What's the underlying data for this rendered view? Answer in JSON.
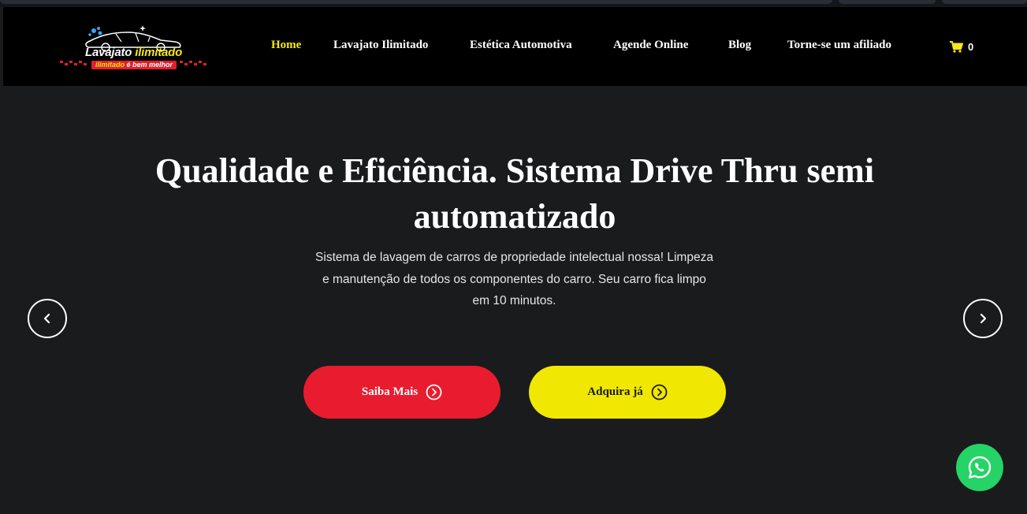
{
  "logo": {
    "brand_main": "Lavajato",
    "brand_accent": "ilimitado",
    "tagline_accent": "ilimitado",
    "tagline_rest": "é bem melhor"
  },
  "nav": {
    "items": [
      {
        "label": "Home",
        "active": true
      },
      {
        "label": "Lavajato Ilimitado",
        "active": false
      },
      {
        "label": "Estética Automotiva",
        "active": false
      },
      {
        "label": "Agende Online",
        "active": false
      },
      {
        "label": "Blog",
        "active": false
      },
      {
        "label": "Torne-se um afiliado",
        "active": false
      }
    ],
    "cart_count": "0",
    "cart_icon": "shopping-cart-icon"
  },
  "hero": {
    "title": "Qualidade e Eficiência. Sistema Drive Thru semi automatizado",
    "subtitle": "Sistema de lavagem de carros de propriedade intelectual nossa! Limpeza e manutenção de todos os componentes do carro. Seu carro fica limpo em 10 minutos.",
    "buttons": {
      "primary_label": "Saiba Mais",
      "secondary_label": "Adquira já"
    }
  },
  "colors": {
    "accent_yellow": "#f6e716",
    "accent_red": "#e81c2e",
    "button_yellow": "#f0e803",
    "whatsapp_green": "#25d366",
    "background": "#1a1b1d",
    "header": "#000000"
  },
  "icons": {
    "prev": "chevron-left-icon",
    "next": "chevron-right-icon",
    "cta": "arrow-circle-right-icon",
    "chat": "whatsapp-icon"
  }
}
